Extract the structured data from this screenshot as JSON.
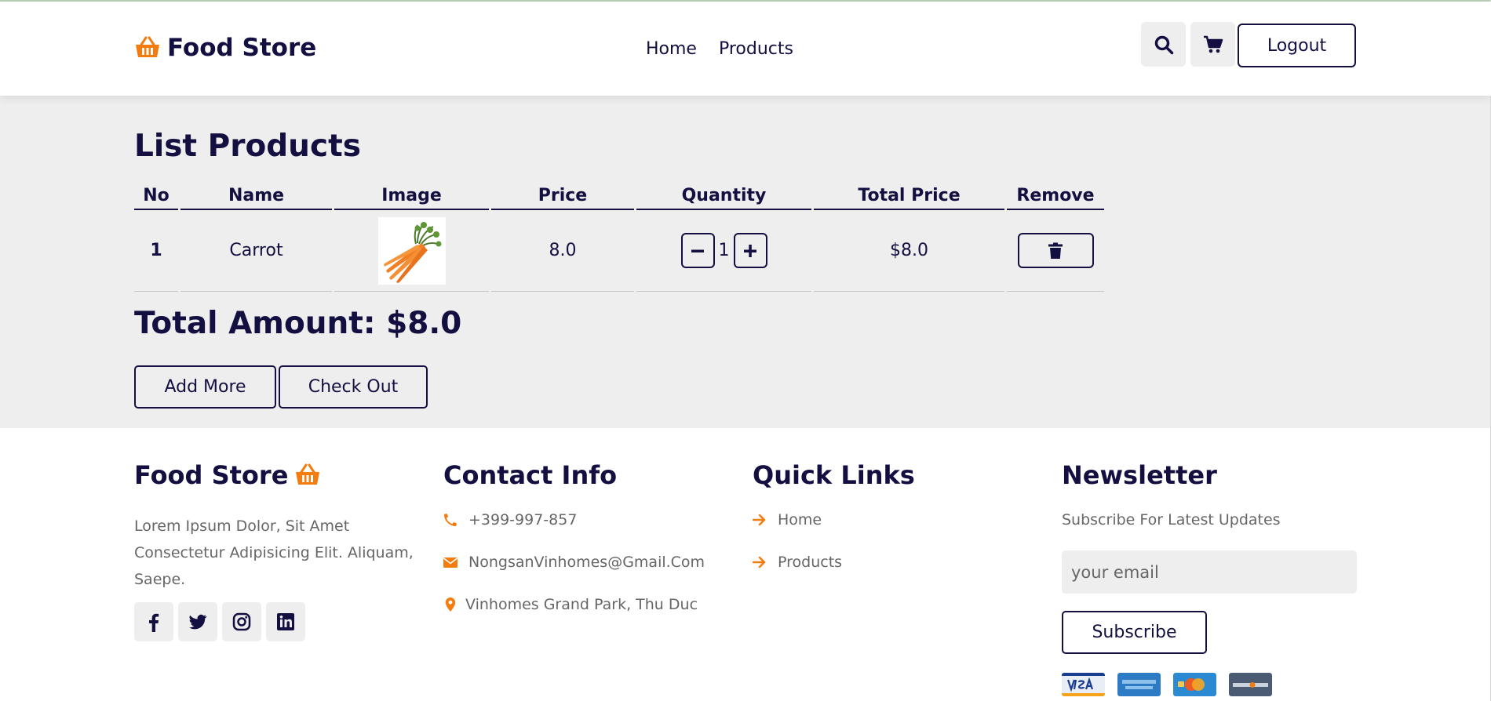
{
  "header": {
    "brand": "Food Store",
    "nav": [
      "Home",
      "Products"
    ],
    "logout_label": "Logout"
  },
  "main": {
    "title": "List Products",
    "columns": [
      "No",
      "Name",
      "Image",
      "Price",
      "Quantity",
      "Total Price",
      "Remove"
    ],
    "rows": [
      {
        "no": "1",
        "name": "Carrot",
        "price": "8.0",
        "quantity": "1",
        "total": "$8.0"
      }
    ],
    "total_amount": "Total Amount: $8.0",
    "add_more_label": "Add More",
    "checkout_label": "Check Out"
  },
  "footer": {
    "brand_title": "Food Store",
    "brand_desc": "Lorem Ipsum Dolor, Sit Amet Consectetur Adipisicing Elit. Aliquam, Saepe.",
    "contact_title": "Contact Info",
    "phone": "+399-997-857",
    "email": "NongsanVinhomes@Gmail.Com",
    "address": "Vinhomes Grand Park, Thu Duc",
    "quicklinks_title": "Quick Links",
    "quicklinks": [
      "Home",
      "Products"
    ],
    "newsletter_title": "Newsletter",
    "newsletter_subtitle": "Subscribe For Latest Updates",
    "email_placeholder": "your email",
    "subscribe_label": "Subscribe"
  },
  "colors": {
    "accent": "#f47c0e",
    "primary": "#130f40",
    "section_bg": "#eeeeee"
  },
  "icons": [
    "basket-icon",
    "search-icon",
    "cart-icon",
    "minus-icon",
    "plus-icon",
    "trash-icon",
    "facebook-icon",
    "twitter-icon",
    "instagram-icon",
    "linkedin-icon",
    "phone-icon",
    "envelope-icon",
    "map-marker-icon",
    "arrow-right-icon",
    "visa-card-icon",
    "amex-card-icon",
    "mastercard-icon",
    "discover-card-icon"
  ]
}
